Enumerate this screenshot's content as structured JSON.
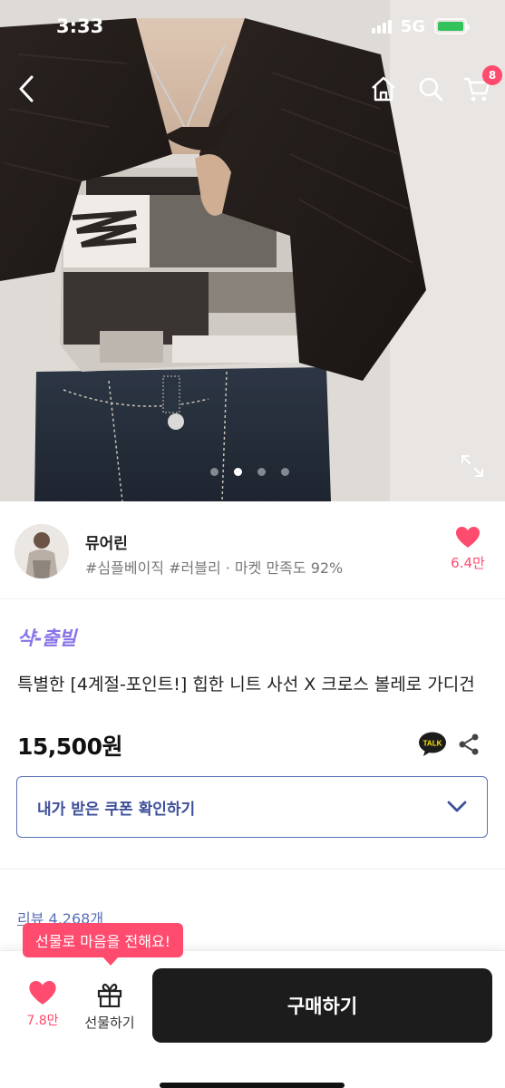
{
  "status_bar": {
    "time": "3:33",
    "network": "5G"
  },
  "header": {
    "cart_count": "8"
  },
  "hero": {
    "image_count": 4,
    "active_index": 1
  },
  "seller": {
    "name": "뮤어린",
    "tags": "#심플베이직 #러블리 · 마켓 만족도 92%",
    "like_count": "6.4만"
  },
  "product": {
    "brand_tag": "샥-출빌",
    "title": "특별한 [4계절-포인트!] 힙한 니트 사선 X 크로스 볼레로 가디건",
    "price": "15,500원",
    "talk_label": "TALK"
  },
  "coupon": {
    "label": "내가 받은 쿠폰 확인하기"
  },
  "reviews": {
    "label": "리뷰 4,268개"
  },
  "bottom_bar": {
    "gift_tooltip": "선물로 마음을 전해요!",
    "wish_count": "7.8만",
    "gift_label": "선물하기",
    "buy_label": "구매하기"
  },
  "colors": {
    "accent": "#ff4b6e",
    "brand_purple": "#8a74e8",
    "coupon_blue": "#3d4f9a",
    "buy_button": "#1c1c1c"
  }
}
